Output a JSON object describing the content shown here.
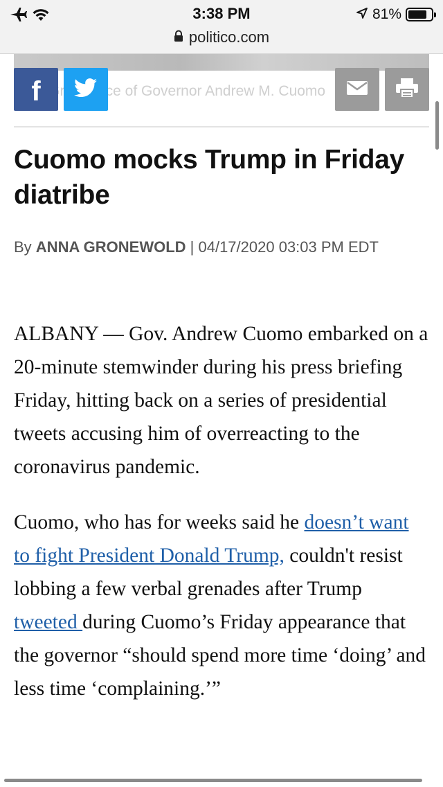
{
  "status_bar": {
    "time": "3:38 PM",
    "battery_percent": "81%",
    "battery_level": 0.81
  },
  "browser": {
    "url": "politico.com"
  },
  "image": {
    "caption": "Mike Groll/Office of Governor Andrew M. Cuomo"
  },
  "share": {
    "facebook_icon": "facebook-icon",
    "twitter_icon": "twitter-icon",
    "email_icon": "email-icon",
    "print_icon": "print-icon",
    "facebook_color": "#3b5998",
    "twitter_color": "#1da1f2",
    "neutral_color": "#9b9b9b"
  },
  "article": {
    "headline": "Cuomo mocks Trump in Friday diatribe",
    "byline_prefix": "By ",
    "author": "ANNA GRONEWOLD",
    "byline_separator": " | ",
    "timestamp": "04/17/2020 03:03 PM EDT",
    "p1": "ALBANY — Gov. Andrew Cuomo embarked on a 20-minute stemwinder during his press briefing Friday, hitting back on a series of presidential tweets accusing him of overreacting to the coronavirus pandemic.",
    "p2_part1": "Cuomo, who has for weeks said he ",
    "p2_link1": "doesn’t want to fight President Donald Trump,",
    "p2_part2": " couldn't resist lobbing a few verbal grenades after Trump ",
    "p2_link2": "tweeted ",
    "p2_part3": "during Cuomo’s Friday appearance that the governor “should spend more time ‘doing’ and less time ‘complaining.’”",
    "link_color": "#1f5fa8"
  }
}
